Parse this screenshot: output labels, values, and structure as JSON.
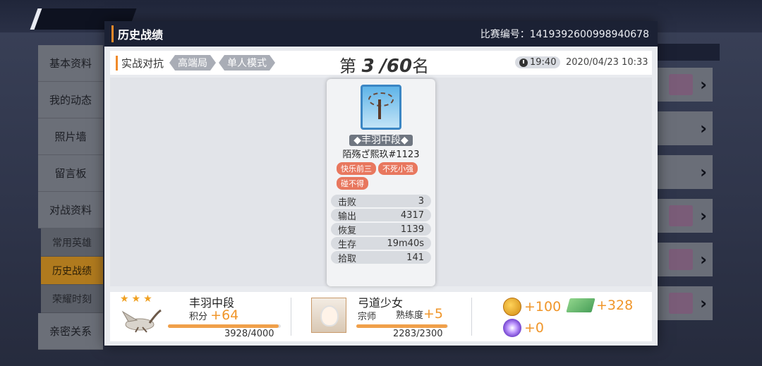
{
  "sidebar": {
    "items": [
      {
        "label": "基本资料"
      },
      {
        "label": "我的动态"
      },
      {
        "label": "照片墙"
      },
      {
        "label": "留言板"
      },
      {
        "label": "对战资料"
      }
    ],
    "subitems": [
      {
        "label": "常用英雄"
      },
      {
        "label": "历史战绩"
      },
      {
        "label": "荣耀时刻"
      }
    ],
    "last_item": {
      "label": "亲密关系"
    }
  },
  "modal": {
    "title": "历史战绩",
    "match_id": "比赛编号：1419392600998940678",
    "mode_label": "实战对抗",
    "tags": [
      "高端局",
      "单人模式"
    ],
    "rank_prefix": "第",
    "rank_number": "3",
    "rank_total": "/60",
    "rank_suffix": "名",
    "duration": "19:40",
    "datetime": "2020/04/23 10:33"
  },
  "player_card": {
    "tier": "◆丰羽中段◆",
    "name": "陌殇ざ熙玖#1123",
    "titles": [
      "快乐前三",
      "不死小强",
      "碰不得"
    ],
    "stats": [
      {
        "label": "击败",
        "value": "3"
      },
      {
        "label": "输出",
        "value": "4317"
      },
      {
        "label": "恢复",
        "value": "1139"
      },
      {
        "label": "生存",
        "value": "19m40s"
      },
      {
        "label": "拾取",
        "value": "141"
      }
    ]
  },
  "footer": {
    "rank_name": "丰羽中段",
    "score_label": "积分",
    "score_delta": "+64",
    "score_progress": "3928/4000",
    "score_fraction": 0.982,
    "hero_name": "弓道少女",
    "hero_role": "宗师",
    "proficiency_label": "熟练度",
    "proficiency_delta": "+5",
    "proficiency_progress": "2283/2300",
    "proficiency_fraction": 0.993,
    "rewards": [
      {
        "icon": "coin-icon",
        "value": "+100"
      },
      {
        "icon": "ticket-icon",
        "value": "+328"
      },
      {
        "icon": "orb-icon",
        "value": "+0"
      }
    ]
  },
  "colors": {
    "accent": "#f08a2a",
    "header_bg": "#1b2134",
    "title_badge": "#e8775e"
  }
}
